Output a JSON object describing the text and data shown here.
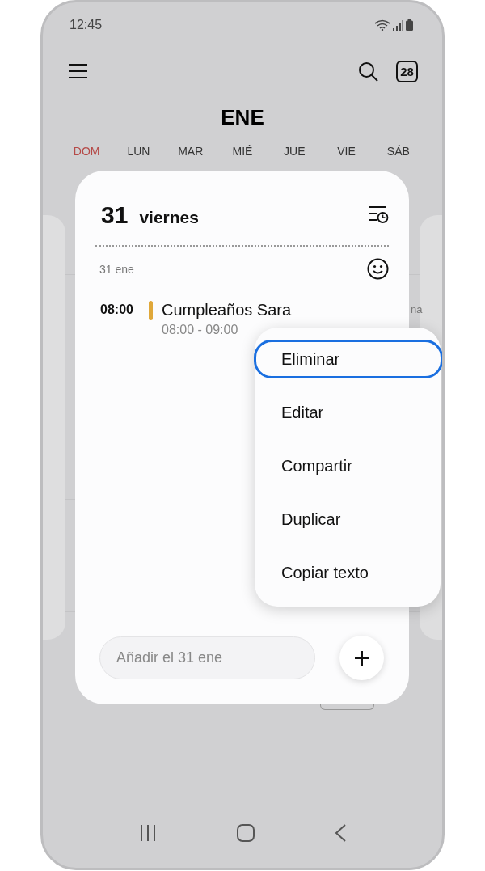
{
  "status_bar": {
    "time": "12:45"
  },
  "toolbar": {
    "today_badge": "28"
  },
  "month": "ENE",
  "weekdays": [
    {
      "label": "DOM",
      "kind": "sunday"
    },
    {
      "label": "LUN",
      "kind": "weekday"
    },
    {
      "label": "MAR",
      "kind": "weekday"
    },
    {
      "label": "MIÉ",
      "kind": "weekday"
    },
    {
      "label": "JUE",
      "kind": "weekday"
    },
    {
      "label": "VIE",
      "kind": "weekday"
    },
    {
      "label": "SÁB",
      "kind": "weekday"
    }
  ],
  "background_text": "na",
  "day_panel": {
    "day_number": "31",
    "weekday": "viernes",
    "date_label": "31 ene",
    "events": [
      {
        "time": "08:00",
        "title": "Cumpleaños Sara",
        "range": "08:00 - 09:00",
        "color": "#e0a83a"
      }
    ],
    "add_field": {
      "placeholder": "Añadir el 31 ene"
    }
  },
  "context_menu": [
    {
      "label": "Eliminar",
      "focused": true
    },
    {
      "label": "Editar",
      "focused": false
    },
    {
      "label": "Compartir",
      "focused": false
    },
    {
      "label": "Duplicar",
      "focused": false
    },
    {
      "label": "Copiar texto",
      "focused": false
    }
  ]
}
